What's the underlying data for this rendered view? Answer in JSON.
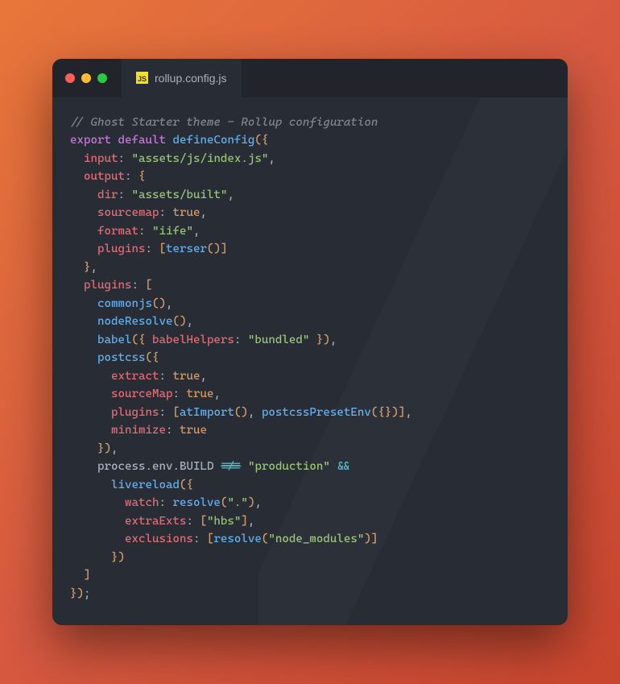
{
  "tab": {
    "filename": "rollup.config.js",
    "icon_label": "JS"
  },
  "code": {
    "comment": "// Ghost Starter theme - Rollup configuration",
    "kw_export": "export",
    "kw_default": "default",
    "fn_defineConfig": "defineConfig",
    "prop_input": "input",
    "str_input": "\"assets/js/index.js\"",
    "prop_output": "output",
    "prop_dir": "dir",
    "str_dir": "\"assets/built\"",
    "prop_sourcemap": "sourcemap",
    "bool_true": "true",
    "prop_format": "format",
    "str_iife": "\"iife\"",
    "prop_plugins": "plugins",
    "fn_terser": "terser",
    "fn_commonjs": "commonjs",
    "fn_nodeResolve": "nodeResolve",
    "fn_babel": "babel",
    "prop_babelHelpers": "babelHelpers",
    "str_bundled": "\"bundled\"",
    "fn_postcss": "postcss",
    "prop_extract": "extract",
    "prop_sourceMap": "sourceMap",
    "fn_atImport": "atImport",
    "fn_postcssPresetEnv": "postcssPresetEnv",
    "prop_minimize": "minimize",
    "var_process": "process",
    "var_env": "env",
    "var_BUILD": "BUILD",
    "op_noteq": "!==",
    "str_production": "\"production\"",
    "op_and": "&&",
    "fn_livereload": "livereload",
    "prop_watch": "watch",
    "fn_resolve": "resolve",
    "str_dot": "\".\"",
    "prop_extraExts": "extraExts",
    "str_hbs": "\"hbs\"",
    "prop_exclusions": "exclusions",
    "str_node_modules": "\"node_modules\""
  },
  "colors": {
    "bg": "#282c34",
    "titlebar": "#21252b",
    "text": "#abb2bf",
    "comment": "#7f848e",
    "keyword": "#c678dd",
    "function": "#61afef",
    "property": "#e06c75",
    "string": "#98c379",
    "number": "#d19a66",
    "operator": "#56b6c2"
  }
}
